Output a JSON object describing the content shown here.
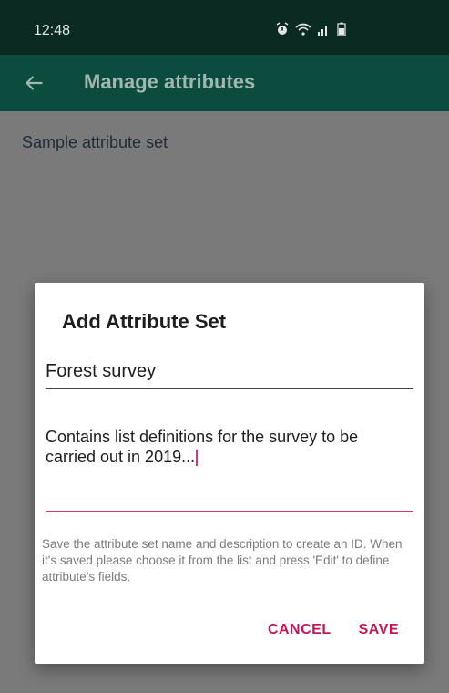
{
  "status": {
    "time": "12:48"
  },
  "appbar": {
    "title": "Manage attributes"
  },
  "list": {
    "items": [
      "Sample attribute set"
    ]
  },
  "dialog": {
    "title": "Add Attribute Set",
    "name_value": "Forest survey",
    "description_value": "Contains list definitions for the survey to be carried out in 2019...",
    "help_text": "Save the attribute set name and description to create an ID. When it's saved please choose it from the list and press 'Edit' to define attribute's fields.",
    "cancel_label": "CANCEL",
    "save_label": "SAVE"
  },
  "icons": [
    "alarm-icon",
    "wifi-icon",
    "signal-icon",
    "battery-icon",
    "back-arrow-icon"
  ],
  "colors": {
    "status_bar": "#0b2b22",
    "app_bar": "#0b4c3e",
    "accent": "#c2185b",
    "scrim_bg": "#7a7a7a"
  }
}
